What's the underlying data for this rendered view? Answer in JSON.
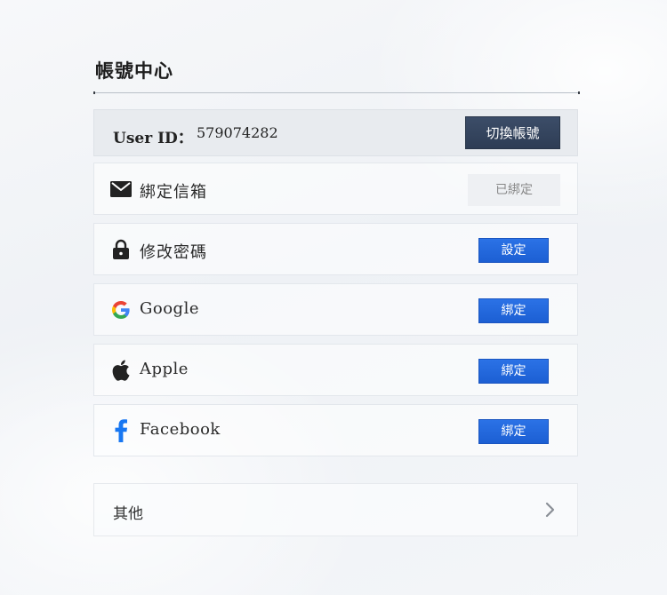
{
  "page": {
    "title": "帳號中心"
  },
  "user": {
    "id_label": "User ID：",
    "id_value": "579074282",
    "switch_label": "切換帳號"
  },
  "rows": [
    {
      "icon": "mail-icon",
      "label": "綁定信箱",
      "button": "已綁定",
      "state": "bound"
    },
    {
      "icon": "lock-icon",
      "label": "修改密碼",
      "button": "設定",
      "state": "action"
    },
    {
      "icon": "google-icon",
      "label": "Google",
      "button": "綁定",
      "state": "action"
    },
    {
      "icon": "apple-icon",
      "label": "Apple",
      "button": "綁定",
      "state": "action"
    },
    {
      "icon": "facebook-icon",
      "label": "Facebook",
      "button": "綁定",
      "state": "action"
    }
  ],
  "other": {
    "label": "其他"
  },
  "colors": {
    "primary_blue": "#1c5fd3",
    "switch_button": "#2e3d55",
    "facebook_blue": "#1877f2"
  }
}
